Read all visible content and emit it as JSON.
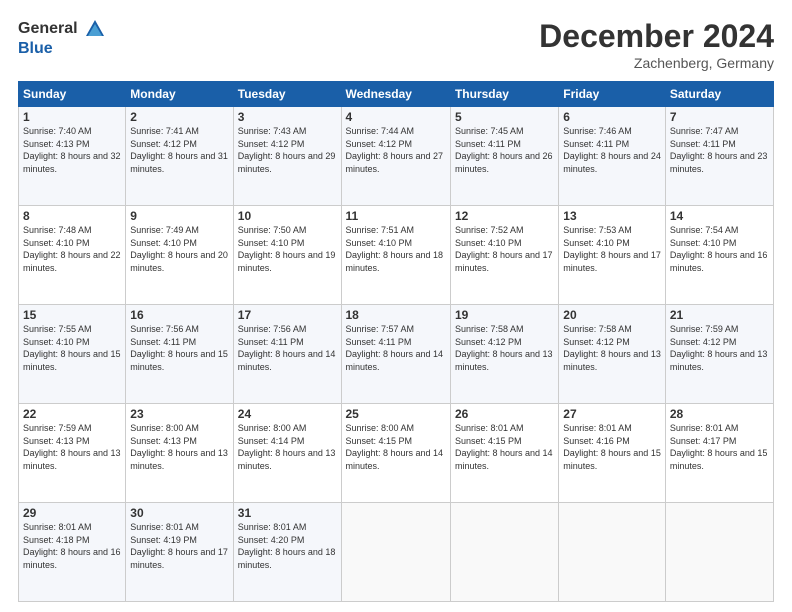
{
  "header": {
    "logo_line1": "General",
    "logo_line2": "Blue",
    "month": "December 2024",
    "location": "Zachenberg, Germany"
  },
  "days_of_week": [
    "Sunday",
    "Monday",
    "Tuesday",
    "Wednesday",
    "Thursday",
    "Friday",
    "Saturday"
  ],
  "weeks": [
    [
      {
        "day": "1",
        "sunrise": "7:40 AM",
        "sunset": "4:13 PM",
        "daylight": "8 hours and 32 minutes."
      },
      {
        "day": "2",
        "sunrise": "7:41 AM",
        "sunset": "4:12 PM",
        "daylight": "8 hours and 31 minutes."
      },
      {
        "day": "3",
        "sunrise": "7:43 AM",
        "sunset": "4:12 PM",
        "daylight": "8 hours and 29 minutes."
      },
      {
        "day": "4",
        "sunrise": "7:44 AM",
        "sunset": "4:12 PM",
        "daylight": "8 hours and 27 minutes."
      },
      {
        "day": "5",
        "sunrise": "7:45 AM",
        "sunset": "4:11 PM",
        "daylight": "8 hours and 26 minutes."
      },
      {
        "day": "6",
        "sunrise": "7:46 AM",
        "sunset": "4:11 PM",
        "daylight": "8 hours and 24 minutes."
      },
      {
        "day": "7",
        "sunrise": "7:47 AM",
        "sunset": "4:11 PM",
        "daylight": "8 hours and 23 minutes."
      }
    ],
    [
      {
        "day": "8",
        "sunrise": "7:48 AM",
        "sunset": "4:10 PM",
        "daylight": "8 hours and 22 minutes."
      },
      {
        "day": "9",
        "sunrise": "7:49 AM",
        "sunset": "4:10 PM",
        "daylight": "8 hours and 20 minutes."
      },
      {
        "day": "10",
        "sunrise": "7:50 AM",
        "sunset": "4:10 PM",
        "daylight": "8 hours and 19 minutes."
      },
      {
        "day": "11",
        "sunrise": "7:51 AM",
        "sunset": "4:10 PM",
        "daylight": "8 hours and 18 minutes."
      },
      {
        "day": "12",
        "sunrise": "7:52 AM",
        "sunset": "4:10 PM",
        "daylight": "8 hours and 17 minutes."
      },
      {
        "day": "13",
        "sunrise": "7:53 AM",
        "sunset": "4:10 PM",
        "daylight": "8 hours and 17 minutes."
      },
      {
        "day": "14",
        "sunrise": "7:54 AM",
        "sunset": "4:10 PM",
        "daylight": "8 hours and 16 minutes."
      }
    ],
    [
      {
        "day": "15",
        "sunrise": "7:55 AM",
        "sunset": "4:10 PM",
        "daylight": "8 hours and 15 minutes."
      },
      {
        "day": "16",
        "sunrise": "7:56 AM",
        "sunset": "4:11 PM",
        "daylight": "8 hours and 15 minutes."
      },
      {
        "day": "17",
        "sunrise": "7:56 AM",
        "sunset": "4:11 PM",
        "daylight": "8 hours and 14 minutes."
      },
      {
        "day": "18",
        "sunrise": "7:57 AM",
        "sunset": "4:11 PM",
        "daylight": "8 hours and 14 minutes."
      },
      {
        "day": "19",
        "sunrise": "7:58 AM",
        "sunset": "4:12 PM",
        "daylight": "8 hours and 13 minutes."
      },
      {
        "day": "20",
        "sunrise": "7:58 AM",
        "sunset": "4:12 PM",
        "daylight": "8 hours and 13 minutes."
      },
      {
        "day": "21",
        "sunrise": "7:59 AM",
        "sunset": "4:12 PM",
        "daylight": "8 hours and 13 minutes."
      }
    ],
    [
      {
        "day": "22",
        "sunrise": "7:59 AM",
        "sunset": "4:13 PM",
        "daylight": "8 hours and 13 minutes."
      },
      {
        "day": "23",
        "sunrise": "8:00 AM",
        "sunset": "4:13 PM",
        "daylight": "8 hours and 13 minutes."
      },
      {
        "day": "24",
        "sunrise": "8:00 AM",
        "sunset": "4:14 PM",
        "daylight": "8 hours and 13 minutes."
      },
      {
        "day": "25",
        "sunrise": "8:00 AM",
        "sunset": "4:15 PM",
        "daylight": "8 hours and 14 minutes."
      },
      {
        "day": "26",
        "sunrise": "8:01 AM",
        "sunset": "4:15 PM",
        "daylight": "8 hours and 14 minutes."
      },
      {
        "day": "27",
        "sunrise": "8:01 AM",
        "sunset": "4:16 PM",
        "daylight": "8 hours and 15 minutes."
      },
      {
        "day": "28",
        "sunrise": "8:01 AM",
        "sunset": "4:17 PM",
        "daylight": "8 hours and 15 minutes."
      }
    ],
    [
      {
        "day": "29",
        "sunrise": "8:01 AM",
        "sunset": "4:18 PM",
        "daylight": "8 hours and 16 minutes."
      },
      {
        "day": "30",
        "sunrise": "8:01 AM",
        "sunset": "4:19 PM",
        "daylight": "8 hours and 17 minutes."
      },
      {
        "day": "31",
        "sunrise": "8:01 AM",
        "sunset": "4:20 PM",
        "daylight": "8 hours and 18 minutes."
      },
      null,
      null,
      null,
      null
    ]
  ]
}
